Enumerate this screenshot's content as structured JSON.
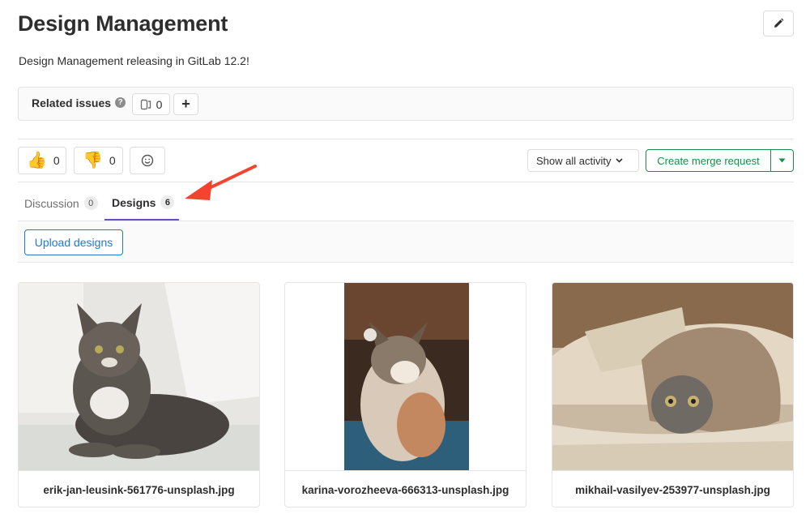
{
  "header": {
    "title": "Design Management",
    "description": "Design Management releasing in GitLab 12.2!",
    "edit_icon": "pencil-icon"
  },
  "related_issues": {
    "label": "Related issues",
    "help_icon": "question-circle-icon",
    "count": "0",
    "add_label": "+"
  },
  "awards": {
    "thumbs_up": {
      "icon": "thumbs-up-icon",
      "count": "0"
    },
    "thumbs_down": {
      "icon": "thumbs-down-icon",
      "count": "0"
    },
    "add_reaction_icon": "smiley-icon"
  },
  "activity": {
    "label": "Show all activity"
  },
  "merge_request": {
    "label": "Create merge request",
    "color": "#168f48"
  },
  "tabs": [
    {
      "label": "Discussion",
      "count": "0"
    },
    {
      "label": "Designs",
      "count": "6"
    }
  ],
  "tab_accent": "#6b4fbb",
  "upload": {
    "label": "Upload designs",
    "color": "#1f78d1"
  },
  "designs": [
    {
      "filename": "erik-jan-leusink-561776-unsplash.jpg"
    },
    {
      "filename": "karina-vorozheeva-666313-unsplash.jpg"
    },
    {
      "filename": "mikhail-vasilyev-253977-unsplash.jpg"
    }
  ]
}
